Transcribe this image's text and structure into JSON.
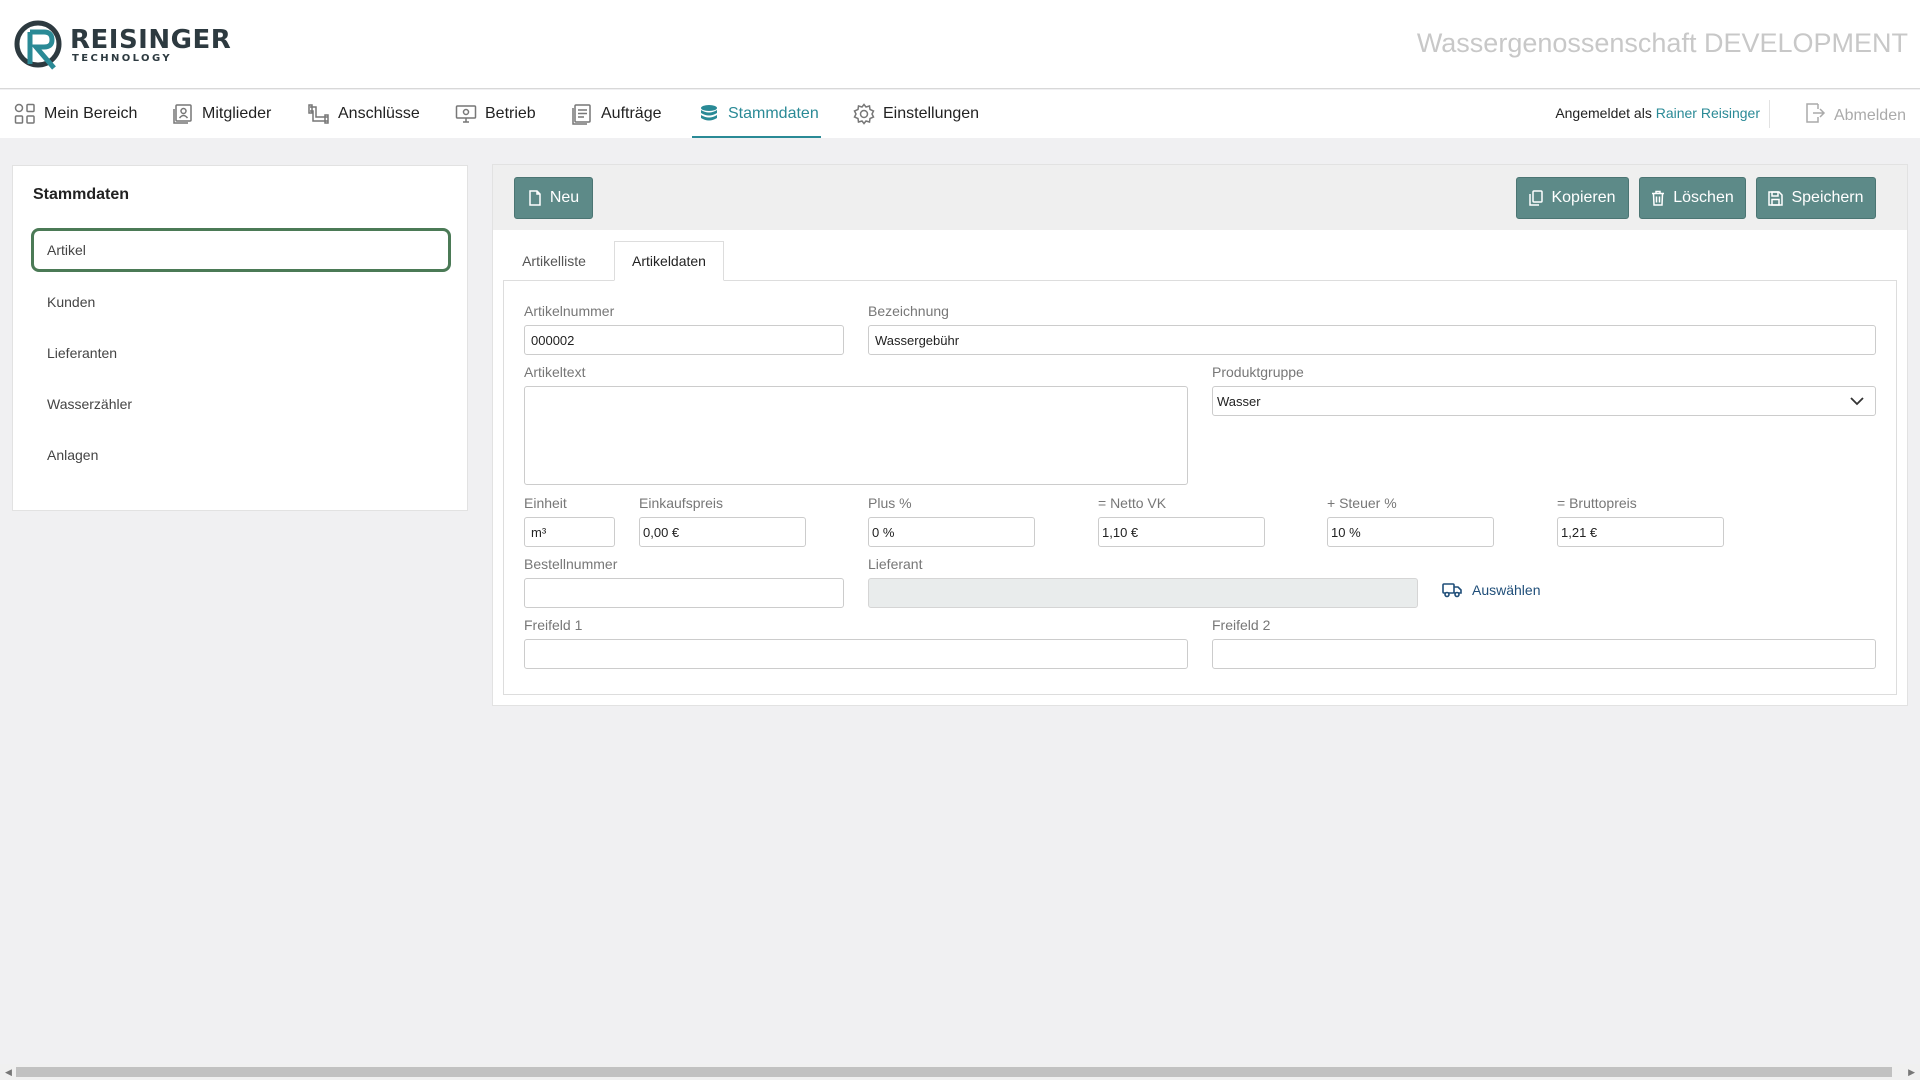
{
  "brand": {
    "name": "REISINGER",
    "sub": "TECHNOLOGY"
  },
  "app_title": "Wassergenossenschaft DEVELOPMENT",
  "nav": {
    "items": [
      {
        "label": "Mein Bereich",
        "icon": "grid-icon"
      },
      {
        "label": "Mitglieder",
        "icon": "members-icon"
      },
      {
        "label": "Anschlüsse",
        "icon": "pipe-icon"
      },
      {
        "label": "Betrieb",
        "icon": "monitor-icon"
      },
      {
        "label": "Aufträge",
        "icon": "document-icon"
      },
      {
        "label": "Stammdaten",
        "icon": "database-icon",
        "active": true
      },
      {
        "label": "Einstellungen",
        "icon": "gear-icon"
      }
    ],
    "login_prefix": "Angemeldet als",
    "login_user": "Rainer Reisinger",
    "logout": "Abmelden"
  },
  "sidebar": {
    "title": "Stammdaten",
    "items": [
      {
        "label": "Artikel",
        "active": true
      },
      {
        "label": "Kunden"
      },
      {
        "label": "Lieferanten"
      },
      {
        "label": "Wasserzähler"
      },
      {
        "label": "Anlagen"
      }
    ]
  },
  "toolbar": {
    "new_label": "Neu",
    "copy_label": "Kopieren",
    "delete_label": "Löschen",
    "save_label": "Speichern"
  },
  "tabs": [
    {
      "label": "Artikelliste"
    },
    {
      "label": "Artikeldaten",
      "active": true
    }
  ],
  "form": {
    "artikelnummer": {
      "label": "Artikelnummer",
      "value": "000002"
    },
    "bezeichnung": {
      "label": "Bezeichnung",
      "value": "Wassergebühr"
    },
    "artikeltext": {
      "label": "Artikeltext",
      "value": ""
    },
    "produktgruppe": {
      "label": "Produktgruppe",
      "value": "Wasser"
    },
    "einheit": {
      "label": "Einheit",
      "value": "m³"
    },
    "einkaufspreis": {
      "label": "Einkaufspreis",
      "value": "0,00 €"
    },
    "plus": {
      "label": "Plus %",
      "value": "0 %"
    },
    "netto_vk": {
      "label": "= Netto VK",
      "value": "1,10 €"
    },
    "steuer": {
      "label": "+ Steuer %",
      "value": "10 %"
    },
    "bruttopreis": {
      "label": "= Bruttopreis",
      "value": "1,21 €"
    },
    "bestellnummer": {
      "label": "Bestellnummer",
      "value": ""
    },
    "lieferant": {
      "label": "Lieferant",
      "value": ""
    },
    "auswaehlen": "Auswählen",
    "freifeld1": {
      "label": "Freifeld 1",
      "value": ""
    },
    "freifeld2": {
      "label": "Freifeld 2",
      "value": ""
    }
  },
  "colors": {
    "accent": "#2a8a96",
    "button": "#5d8a88",
    "active_border": "#4b7a56",
    "link": "#1f4e79"
  }
}
